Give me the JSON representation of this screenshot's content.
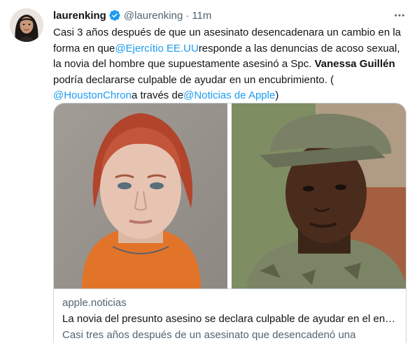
{
  "tweet": {
    "display_name": "laurenking",
    "handle": "@laurenking",
    "separator": "·",
    "time": "11m",
    "text": {
      "p1": "Casi 3 años después de que un asesinato desencadenara un cambio en la forma en que",
      "m1": "@Ejercítio EE.UU",
      "p2": "responde a las denuncias de acoso sexual, la novia del hombre que supuestamente asesinó a Spc. ",
      "b1": "Vanessa Guillén",
      "p3": " podría declararse culpable de ayudar en un encubrimiento. (",
      "m2": "@HoustonChron",
      "p4": "a través de",
      "m3": "@Noticias de Apple",
      "p5": ")"
    },
    "icons": {
      "verified": "verified-badge-icon",
      "more": "more-horizontal-icon"
    },
    "colors": {
      "accent": "#1d9bf0",
      "secondary_text": "#536471",
      "border": "#cfd9de"
    }
  },
  "card": {
    "domain": "apple.noticias",
    "title": "La novia del presunto asesino se declara culpable de ayudar en el enc...",
    "description": "Casi tres años después de un asesinato que desencadenó una"
  }
}
